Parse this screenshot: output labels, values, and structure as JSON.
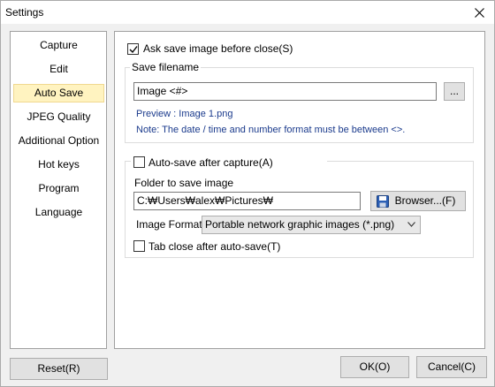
{
  "window": {
    "title": "Settings"
  },
  "sidebar": {
    "items": [
      {
        "label": "Capture"
      },
      {
        "label": "Edit"
      },
      {
        "label": "Auto Save"
      },
      {
        "label": "JPEG Quality"
      },
      {
        "label": "Additional Option"
      },
      {
        "label": "Hot keys"
      },
      {
        "label": "Program"
      },
      {
        "label": "Language"
      }
    ],
    "selected": "Auto Save"
  },
  "ask_save": {
    "label": "Ask save image before close(S)",
    "checked": true
  },
  "save_filename": {
    "legend": "Save filename",
    "value": "Image <#>",
    "browse_label": "...",
    "preview": "Preview : Image 1.png",
    "note": "Note: The date / time and number format must be between <>."
  },
  "auto_save": {
    "label": "Auto-save after capture(A)",
    "checked": false,
    "folder_label": "Folder to save image",
    "folder_value": "C:₩Users₩alex₩Pictures₩",
    "browse_label": "Browser...(F)",
    "format_label": "Image Format",
    "format_value": "Portable network graphic images (*.png)",
    "tab_close_label": "Tab close after auto-save(T)",
    "tab_close_checked": false
  },
  "footer": {
    "reset_label": "Reset(R)",
    "ok_label": "OK(O)",
    "cancel_label": "Cancel(C)"
  }
}
